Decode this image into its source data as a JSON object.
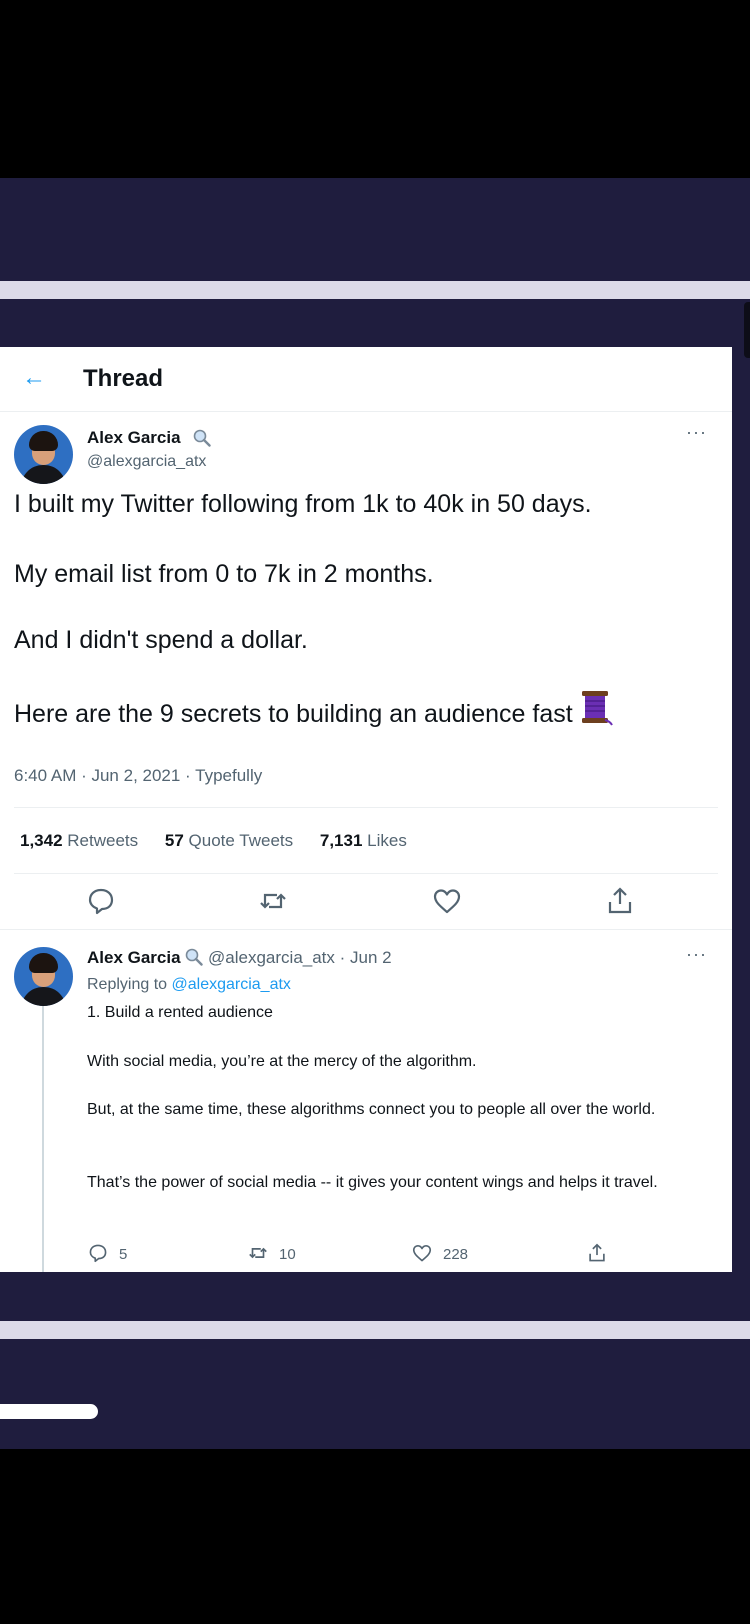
{
  "header": {
    "back_icon": "arrow-left-icon",
    "title": "Thread"
  },
  "tweet": {
    "author_name": "Alex Garcia",
    "author_handle": "@alexgarcia_atx",
    "lines": [
      "I built my Twitter following from 1k to 40k in 50 days.",
      "My email list from 0 to 7k in 2 months.",
      "And I didn't spend a dollar.",
      "Here are the 9 secrets to building an audience fast"
    ],
    "timestamp": "6:40 AM · Jun 2, 2021 · Typefully",
    "stats": {
      "retweets_count": "1,342",
      "retweets_label": "Retweets",
      "quotes_count": "57",
      "quotes_label": "Quote Tweets",
      "likes_count": "7,131",
      "likes_label": "Likes"
    }
  },
  "reply": {
    "author_name": "Alex Garcia",
    "author_handle": "@alexgarcia_atx",
    "date": "· Jun 2",
    "replying_prefix": "Replying to",
    "replying_handle": "@alexgarcia_atx",
    "paragraphs": [
      "1. Build a rented audience",
      "With social media, you’re at the mercy of the algorithm.",
      "But, at the same time, these algorithms connect you to people all over the world.",
      "That’s the power of social media -- it gives your content wings and helps it travel."
    ],
    "reply_count": "5",
    "retweet_count": "10",
    "like_count": "228"
  },
  "colors": {
    "accent": "#1d9bf0",
    "frame": "#1f1d3e",
    "muted": "#536471"
  }
}
